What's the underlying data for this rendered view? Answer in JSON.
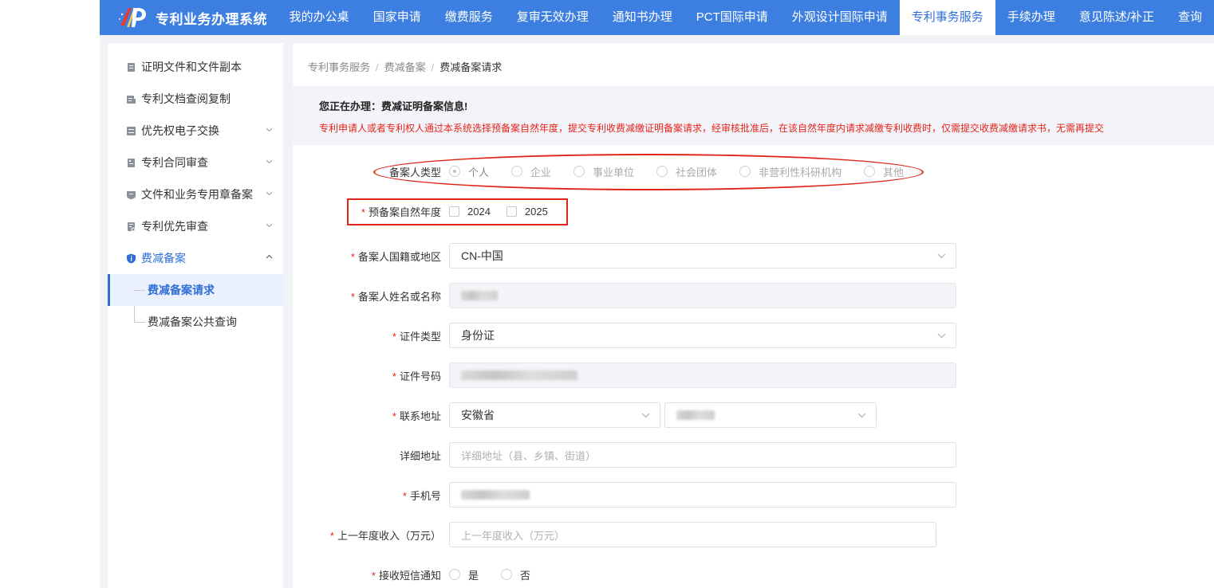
{
  "app": {
    "title": "专利业务办理系统",
    "accent": "#3d7fe0",
    "nav": [
      {
        "label": "我的办公桌",
        "active": false
      },
      {
        "label": "国家申请",
        "active": false
      },
      {
        "label": "缴费服务",
        "active": false
      },
      {
        "label": "复审无效办理",
        "active": false
      },
      {
        "label": "通知书办理",
        "active": false
      },
      {
        "label": "PCT国际申请",
        "active": false
      },
      {
        "label": "外观设计国际申请",
        "active": false
      },
      {
        "label": "专利事务服务",
        "active": true
      },
      {
        "label": "手续办理",
        "active": false
      },
      {
        "label": "意见陈述/补正",
        "active": false
      },
      {
        "label": "查询",
        "active": false
      }
    ]
  },
  "sidebar": {
    "items": [
      {
        "label": "证明文件和文件副本",
        "icon": "document-stack-icon",
        "expandable": false
      },
      {
        "label": "专利文档查阅复制",
        "icon": "document-copy-icon",
        "expandable": false
      },
      {
        "label": "优先权电子交换",
        "icon": "exchange-icon",
        "expandable": true
      },
      {
        "label": "专利合同审查",
        "icon": "contract-icon",
        "expandable": true
      },
      {
        "label": "文件和业务专用章备案",
        "icon": "seal-icon",
        "expandable": true
      },
      {
        "label": "专利优先审查",
        "icon": "priority-icon",
        "expandable": true
      },
      {
        "label": "费减备案",
        "icon": "shield-info-icon",
        "expandable": true,
        "open": true
      }
    ],
    "subitems": [
      {
        "label": "费减备案请求",
        "active": true
      },
      {
        "label": "费减备案公共查询",
        "active": false
      }
    ]
  },
  "breadcrumb": [
    "专利事务服务",
    "费减备案",
    "费减备案请求"
  ],
  "notice": {
    "title": "您正在办理：费减证明备案信息!",
    "text": "专利申请人或者专利权人通过本系统选择预备案自然年度，提交专利收费减缴证明备案请求，经审核批准后，在该自然年度内请求减缴专利收费时，仅需提交收费减缴请求书，无需再提交"
  },
  "form": {
    "applicant_type": {
      "label": "备案人类型",
      "options": [
        "个人",
        "企业",
        "事业单位",
        "社会团体",
        "非营利性科研机构",
        "其他"
      ],
      "selected": "个人"
    },
    "year": {
      "label": "预备案自然年度",
      "options": [
        "2024",
        "2025"
      ]
    },
    "nationality": {
      "label": "备案人国籍或地区",
      "value": "CN-中国"
    },
    "name": {
      "label": "备案人姓名或名称"
    },
    "id_type": {
      "label": "证件类型",
      "value": "身份证"
    },
    "id_number": {
      "label": "证件号码"
    },
    "address": {
      "label": "联系地址",
      "province": "安徽省"
    },
    "detail_address": {
      "label": "详细地址",
      "placeholder": "详细地址（县、乡镇、街道）"
    },
    "phone": {
      "label": "手机号"
    },
    "income": {
      "label": "上一年度收入（万元）",
      "placeholder": "上一年度收入（万元）"
    },
    "sms": {
      "label": "接收短信通知",
      "options": [
        "是",
        "否"
      ]
    }
  },
  "colors": {
    "annotation": "#e02418",
    "required": "#e8231a",
    "active": "#2f6fd6"
  }
}
